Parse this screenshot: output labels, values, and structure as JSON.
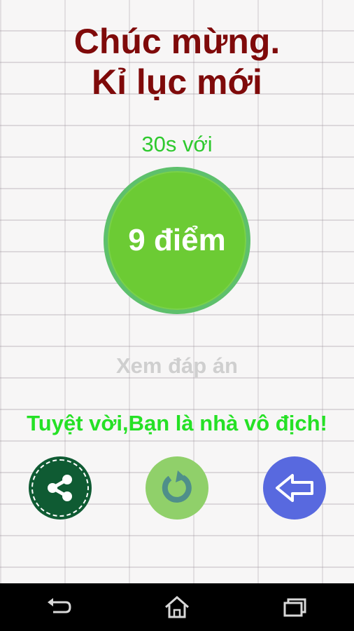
{
  "header": {
    "line1": "Chúc mừng.",
    "line2": "Kỉ lục mới"
  },
  "result": {
    "time_label": "30s với",
    "score_label": "9 điểm"
  },
  "view_answers_label": "Xem đáp án",
  "message": "Tuyệt vời,Bạn là nhà vô địch!",
  "actions": [
    {
      "name": "share-button",
      "icon": "share-icon"
    },
    {
      "name": "replay-button",
      "icon": "replay-icon"
    },
    {
      "name": "back-button",
      "icon": "back-arrow-icon"
    }
  ],
  "nav": [
    {
      "name": "nav-back",
      "icon": "nav-back-icon"
    },
    {
      "name": "nav-home",
      "icon": "nav-home-icon"
    },
    {
      "name": "nav-recents",
      "icon": "nav-recents-icon"
    }
  ],
  "colors": {
    "title": "#7f0a0a",
    "accent_green": "#2ec92e",
    "score_circle": "#6ccb34",
    "message": "#25e125",
    "share_bg": "#0f5b33",
    "replay_bg": "#90d06a",
    "back_bg": "#5869df"
  }
}
